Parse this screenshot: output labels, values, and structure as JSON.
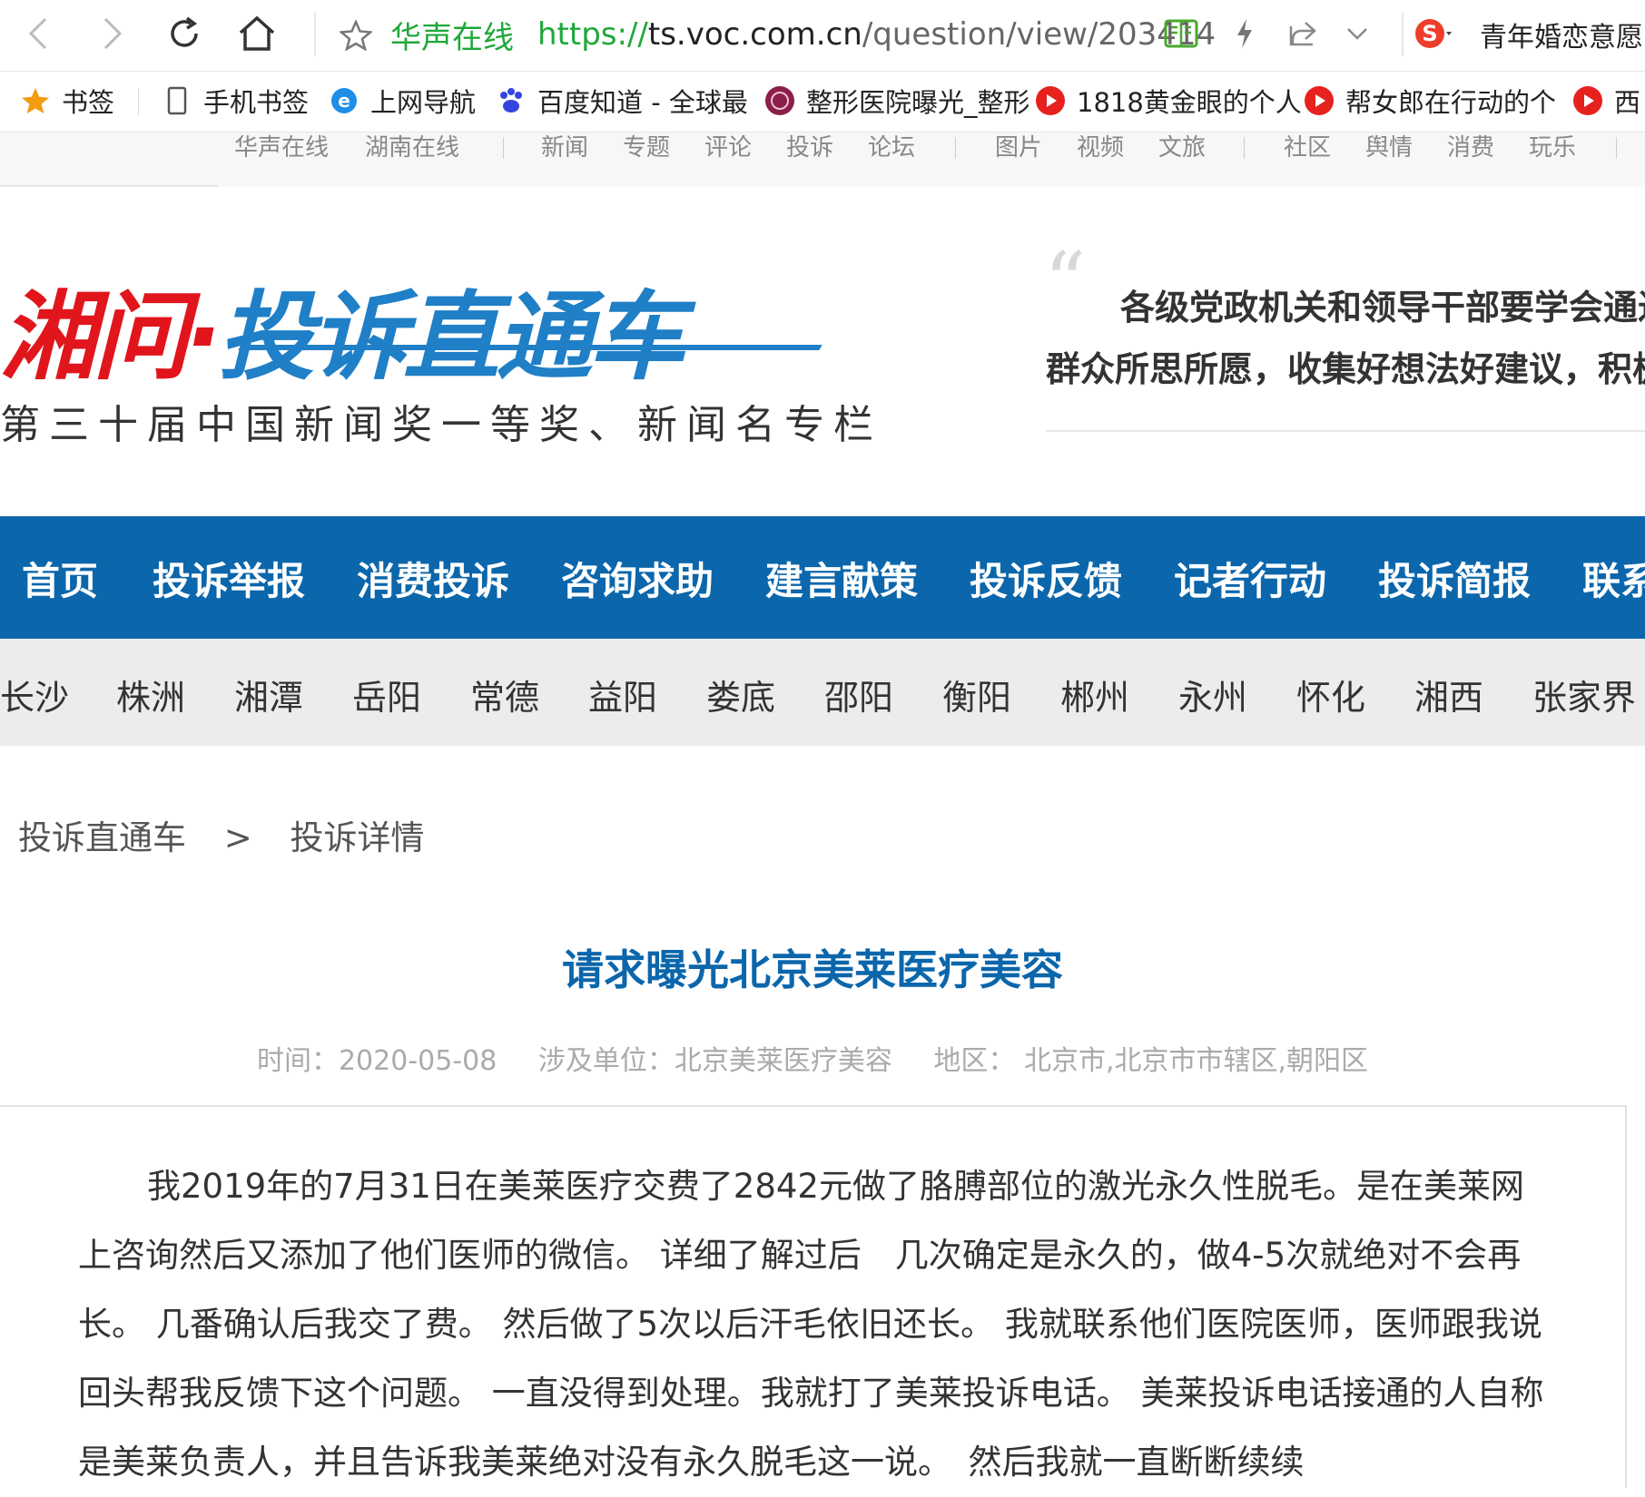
{
  "browser": {
    "url_site": "华声在线",
    "url_protocol": "https://",
    "url_host": "ts.voc.com.cn",
    "url_path": "/question/view/203414",
    "right_tab_title": "青年婚恋意愿"
  },
  "bookmarks": [
    {
      "label": "书签",
      "icon": "star-icon"
    },
    {
      "label": "手机书签",
      "icon": "phone-icon"
    },
    {
      "label": "上网导航",
      "icon": "ie-icon"
    },
    {
      "label": "百度知道 - 全球最",
      "icon": "baidu-paw-icon"
    },
    {
      "label": "整形医院曝光_整形",
      "icon": "clinic-logo-icon"
    },
    {
      "label": "1818黄金眼的个人",
      "icon": "video-play-icon"
    },
    {
      "label": "帮女郎在行动的个",
      "icon": "video-play-icon"
    },
    {
      "label": "西",
      "icon": "video-play-icon"
    }
  ],
  "topnav": {
    "group1": [
      "华声在线",
      "湖南在线"
    ],
    "group2": [
      "新闻",
      "专题",
      "评论",
      "投诉",
      "论坛"
    ],
    "group3": [
      "图片",
      "视频",
      "文旅"
    ],
    "group4": [
      "社区",
      "舆情",
      "消费",
      "玩乐"
    ]
  },
  "header": {
    "logo_red": "湘问·",
    "logo_blue": "投诉直通车",
    "logo_subtitle": "第三十届中国新闻奖一等奖、新闻名专栏",
    "quote_line1": "各级党政机关和领导干部要学会通过",
    "quote_line2": "群众所思所愿，收集好想法好建议，积极"
  },
  "mainnav": [
    "首页",
    "投诉举报",
    "消费投诉",
    "咨询求助",
    "建言献策",
    "投诉反馈",
    "记者行动",
    "投诉简报",
    "联系"
  ],
  "regionnav": [
    "长沙",
    "株洲",
    "湘潭",
    "岳阳",
    "常德",
    "益阳",
    "娄底",
    "邵阳",
    "衡阳",
    "郴州",
    "永州",
    "怀化",
    "湘西",
    "张家界"
  ],
  "breadcrumb": {
    "root": "投诉直通车",
    "separator": ">",
    "current": "投诉详情"
  },
  "article": {
    "title": "请求曝光北京美莱医疗美容",
    "time": "时间：2020-05-08",
    "unit": "涉及单位：北京美莱医疗美容",
    "region": "地区： 北京市,北京市市辖区,朝阳区",
    "body": "我2019年的7月31日在美莱医疗交费了2842元做了胳膊部位的激光永久性脱毛。是在美莱网上咨询然后又添加了他们医师的微信。 详细了解过后　几次确定是永久的，做4-5次就绝对不会再长。 几番确认后我交了费。 然后做了5次以后汗毛依旧还长。 我就联系他们医院医师，医师跟我说回头帮我反馈下这个问题。 一直没得到处理。我就打了美莱投诉电话。 美莱投诉电话接通的人自称是美莱负责人，并且告诉我美莱绝对没有永久脱毛这一说。　然后我就一直断断续续"
  },
  "colors": {
    "brand_blue": "#0b66ab",
    "logo_red": "#e0161c",
    "logo_blue": "#1f7fc7",
    "url_green": "#1fa83a"
  }
}
